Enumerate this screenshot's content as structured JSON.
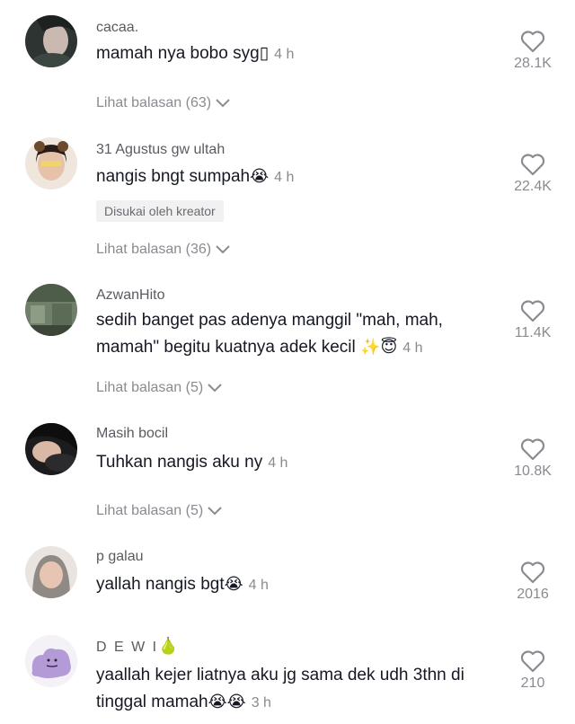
{
  "comments": [
    {
      "username": "cacaa.",
      "text": "mamah nya bobo syg▯",
      "emoji": "",
      "time": "4 h",
      "badge": "",
      "replies": "Lihat balasan (63)",
      "likes": "28.1K",
      "avatar_icon": "profile-photo"
    },
    {
      "username": "31 Agustus gw ultah",
      "text": "nangis bngt sumpah",
      "emoji": "😭",
      "time": "4 h",
      "badge": "Disukai oleh kreator",
      "replies": "Lihat balasan (36)",
      "likes": "22.4K",
      "avatar_icon": "profile-photo"
    },
    {
      "username": "AzwanHito",
      "text": "sedih banget pas adenya manggil \"mah, mah, mamah\" begitu kuatnya adek kecil ",
      "emoji": "✨😇",
      "time": "4 h",
      "badge": "",
      "replies": "Lihat balasan (5)",
      "likes": "11.4K",
      "avatar_icon": "profile-photo"
    },
    {
      "username": "Masih bocil",
      "text": "Tuhkan nangis aku ny",
      "emoji": "",
      "time": "4 h",
      "badge": "",
      "replies": "Lihat balasan (5)",
      "likes": "10.8K",
      "avatar_icon": "profile-photo"
    },
    {
      "username": "p galau",
      "text": "yallah nangis bgt",
      "emoji": "😭",
      "time": "4 h",
      "badge": "",
      "replies": "",
      "likes": "2016",
      "avatar_icon": "profile-photo"
    },
    {
      "username": "D E W I",
      "username_emoji": "🍐",
      "text": "yaallah kejer liatnya aku jg sama dek udh 3thn di tinggal mamah",
      "emoji": "😭😭",
      "time": "3 h",
      "badge": "",
      "replies": "",
      "likes": "210",
      "avatar_icon": "purple-blob-avatar"
    }
  ],
  "colors": {
    "username": "#5a5a60",
    "text": "#161823",
    "muted": "#8a8b91",
    "badge_bg": "#f1f1f2"
  }
}
